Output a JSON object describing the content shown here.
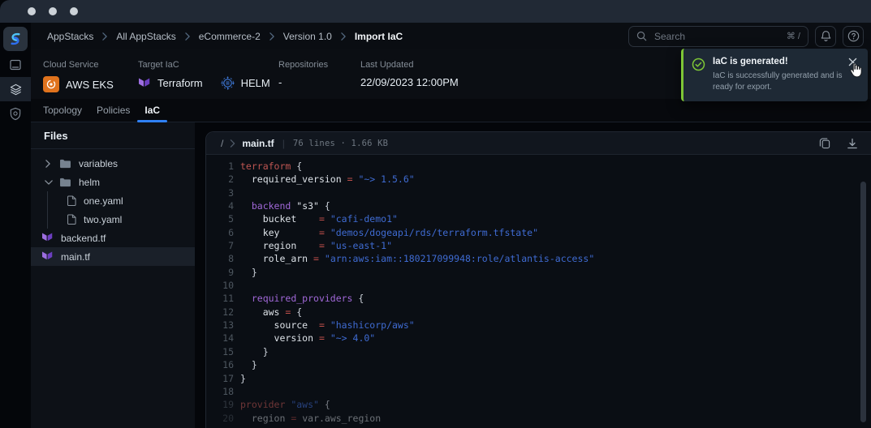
{
  "colors": {
    "accent_blue": "#2f81f7",
    "success_green": "#7ec636",
    "terraform_purple": "#844fba",
    "helm_blue": "#3f7bdc",
    "aws_orange": "#e0731d"
  },
  "icons": {
    "search": "magnifier",
    "notifications": "bell",
    "help": "question-circle",
    "copy": "overlapping-squares",
    "download": "arrow-down-to-line",
    "toast_status": "check-circle",
    "close": "x",
    "folder": "folder",
    "yaml_file": "page",
    "terraform": "terraform-mark",
    "helm": "ship-wheel",
    "aws_eks": "eks-orange-square"
  },
  "nav": {
    "breadcrumb": [
      "AppStacks",
      "All AppStacks",
      "eCommerce-2",
      "Version 1.0",
      "Import IaC"
    ],
    "search": {
      "placeholder": "Search",
      "shortcut": "⌘ /"
    }
  },
  "summary": {
    "fields": [
      {
        "label": "Cloud Service",
        "items": [
          {
            "icon": "aws-eks-icon",
            "text": "AWS EKS"
          }
        ]
      },
      {
        "label": "Target IaC",
        "items": [
          {
            "icon": "terraform-icon",
            "text": "Terraform"
          },
          {
            "icon": "helm-icon",
            "text": "HELM"
          }
        ]
      },
      {
        "label": "Repositories",
        "items": [
          {
            "icon": null,
            "text": "-"
          }
        ]
      },
      {
        "label": "Last Updated",
        "items": [
          {
            "icon": null,
            "text": "22/09/2023 12:00PM"
          }
        ]
      }
    ]
  },
  "toast": {
    "title": "IaC is generated!",
    "message": "IaC is successfully generated and is ready for export."
  },
  "tabs": [
    {
      "label": "Topology",
      "active": false
    },
    {
      "label": "Policies",
      "active": false
    },
    {
      "label": "IaC",
      "active": true
    }
  ],
  "files_panel": {
    "title": "Files",
    "tree": [
      {
        "type": "folder",
        "name": "variables",
        "expanded": false,
        "level": 0
      },
      {
        "type": "folder",
        "name": "helm",
        "expanded": true,
        "level": 0
      },
      {
        "type": "file",
        "kind": "yaml",
        "name": "one.yaml",
        "level": 1
      },
      {
        "type": "file",
        "kind": "yaml",
        "name": "two.yaml",
        "level": 1
      },
      {
        "type": "file",
        "kind": "terraform",
        "name": "backend.tf",
        "level": 0
      },
      {
        "type": "file",
        "kind": "terraform",
        "name": "main.tf",
        "level": 0,
        "selected": true
      }
    ]
  },
  "editor": {
    "path_root": "/",
    "filename": "main.tf",
    "stats": "76 lines · 1.66 KB",
    "code_lines": [
      [
        [
          "kw",
          "terraform"
        ],
        [
          "pl",
          " {"
        ]
      ],
      [
        [
          "pl",
          "  "
        ],
        [
          "id",
          "required_version"
        ],
        [
          "pl",
          " "
        ],
        [
          "op",
          "="
        ],
        [
          "pl",
          " "
        ],
        [
          "str",
          "\"~> 1.5.6\""
        ]
      ],
      [],
      [
        [
          "pl",
          "  "
        ],
        [
          "blk",
          "backend"
        ],
        [
          "pl",
          " "
        ],
        [
          "id",
          "\"s3\""
        ],
        [
          "pl",
          " {"
        ]
      ],
      [
        [
          "pl",
          "    "
        ],
        [
          "id",
          "bucket"
        ],
        [
          "pl",
          "    "
        ],
        [
          "op",
          "="
        ],
        [
          "pl",
          " "
        ],
        [
          "str",
          "\"cafi-demo1\""
        ]
      ],
      [
        [
          "pl",
          "    "
        ],
        [
          "id",
          "key"
        ],
        [
          "pl",
          "       "
        ],
        [
          "op",
          "="
        ],
        [
          "pl",
          " "
        ],
        [
          "str",
          "\"demos/dogeapi/rds/terraform.tfstate\""
        ]
      ],
      [
        [
          "pl",
          "    "
        ],
        [
          "id",
          "region"
        ],
        [
          "pl",
          "    "
        ],
        [
          "op",
          "="
        ],
        [
          "pl",
          " "
        ],
        [
          "str",
          "\"us-east-1\""
        ]
      ],
      [
        [
          "pl",
          "    "
        ],
        [
          "id",
          "role_arn"
        ],
        [
          "pl",
          " "
        ],
        [
          "op",
          "="
        ],
        [
          "pl",
          " "
        ],
        [
          "str",
          "\"arn:aws:iam::180217099948:role/atlantis-access\""
        ]
      ],
      [
        [
          "pl",
          "  }"
        ]
      ],
      [],
      [
        [
          "pl",
          "  "
        ],
        [
          "blk",
          "required_providers"
        ],
        [
          "pl",
          " {"
        ]
      ],
      [
        [
          "pl",
          "    "
        ],
        [
          "id",
          "aws"
        ],
        [
          "pl",
          " "
        ],
        [
          "op",
          "="
        ],
        [
          "pl",
          " {"
        ]
      ],
      [
        [
          "pl",
          "      "
        ],
        [
          "id",
          "source"
        ],
        [
          "pl",
          "  "
        ],
        [
          "op",
          "="
        ],
        [
          "pl",
          " "
        ],
        [
          "str",
          "\"hashicorp/aws\""
        ]
      ],
      [
        [
          "pl",
          "      "
        ],
        [
          "id",
          "version"
        ],
        [
          "pl",
          " "
        ],
        [
          "op",
          "="
        ],
        [
          "pl",
          " "
        ],
        [
          "str",
          "\"~> 4.0\""
        ]
      ],
      [
        [
          "pl",
          "    }"
        ]
      ],
      [
        [
          "pl",
          "  }"
        ]
      ],
      [
        [
          "pl",
          "}"
        ]
      ],
      [],
      [
        [
          "kw",
          "provider"
        ],
        [
          "pl",
          " "
        ],
        [
          "str",
          "\"aws\""
        ],
        [
          "pl",
          " {"
        ]
      ],
      [
        [
          "pl",
          "  "
        ],
        [
          "id",
          "region"
        ],
        [
          "pl",
          " "
        ],
        [
          "op",
          "="
        ],
        [
          "pl",
          " "
        ],
        [
          "id",
          "var.aws_region"
        ]
      ]
    ]
  }
}
